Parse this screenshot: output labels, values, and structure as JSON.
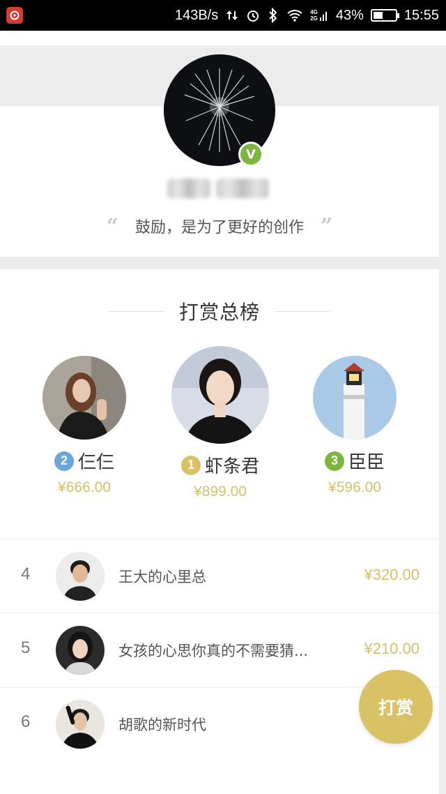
{
  "status_bar": {
    "speed": "143B/s",
    "network": "4G\n2G",
    "battery": "43%",
    "battery_level": 0.43,
    "time": "15:55"
  },
  "profile": {
    "verified_mark": "V",
    "quote_open": "“",
    "quote_text": "鼓励，是为了更好的创作",
    "quote_close": "”"
  },
  "ranking": {
    "title": "打赏总榜",
    "top3": [
      {
        "rank": "2",
        "name": "仨仨",
        "amount": "¥666.00",
        "badge_color": "#6aa6d8"
      },
      {
        "rank": "1",
        "name": "虾条君",
        "amount": "¥899.00",
        "badge_color": "#d9c266"
      },
      {
        "rank": "3",
        "name": "臣臣",
        "amount": "¥596.00",
        "badge_color": "#7cb63c"
      }
    ],
    "list": [
      {
        "rank": "4",
        "name": "王大的心里总",
        "amount": "¥320.00"
      },
      {
        "rank": "5",
        "name": "女孩的心思你真的不需要猜...",
        "amount": "¥210.00"
      },
      {
        "rank": "6",
        "name": "胡歌的新时代",
        "amount": "¥"
      }
    ]
  },
  "reward_button": {
    "label": "打赏"
  },
  "colors": {
    "accent": "#d9c266",
    "amount": "#d6c06a",
    "verified": "#7cb63c"
  }
}
